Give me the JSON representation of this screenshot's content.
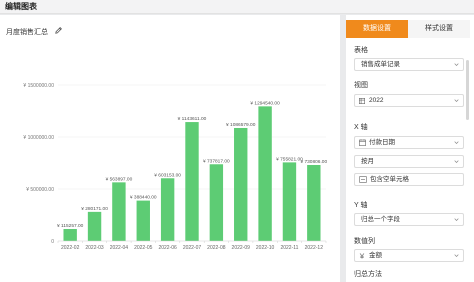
{
  "window": {
    "title": "编辑图表"
  },
  "chart_title": "月度销售汇总",
  "icons": {
    "edit": "pencil-icon"
  },
  "tabs": [
    {
      "label": "数据设置",
      "active": true
    },
    {
      "label": "样式设置",
      "active": false
    }
  ],
  "settings": {
    "table_label": "表格",
    "table_value": "销售成单记录",
    "view_label": "视图",
    "view_value": "2022",
    "x_axis_label": "X 轴",
    "x_field": "付款日期",
    "x_group": "按月",
    "x_include_empty": "包含空单元格",
    "y_axis_label": "Y 轴",
    "y_mode": "归总一个字段",
    "data_col_label": "数值列",
    "data_col_value": "金额",
    "agg_label": "归总方法"
  },
  "colors": {
    "bar": "#5dcc74",
    "accent": "#f08a1c"
  },
  "chart_data": {
    "type": "bar",
    "categories": [
      "2022-02",
      "2022-03",
      "2022-04",
      "2022-05",
      "2022-06",
      "2022-07",
      "2022-08",
      "2022-09",
      "2022-10",
      "2022-11",
      "2022-12"
    ],
    "values": [
      115257,
      280171,
      563897,
      388440,
      603153,
      1143611,
      737817,
      1086579,
      1294540,
      755821,
      730806
    ],
    "data_labels": [
      "¥ 115257.00",
      "¥ 280171.00",
      "¥ 563897.00",
      "¥ 388440.00",
      "¥ 603153.00",
      "¥ 1143611.00",
      "¥ 737817.00",
      "¥ 1086579.00",
      "¥ 1294540.00",
      "¥ 755821.00",
      "¥ 730806.00"
    ],
    "yticks": [
      0,
      500000,
      1000000,
      1500000
    ],
    "ytick_labels": [
      "0",
      "¥ 500000.00",
      "¥ 1000000.00",
      "¥ 1500000.00"
    ],
    "ylim": [
      0,
      1500000
    ],
    "grid": true
  }
}
